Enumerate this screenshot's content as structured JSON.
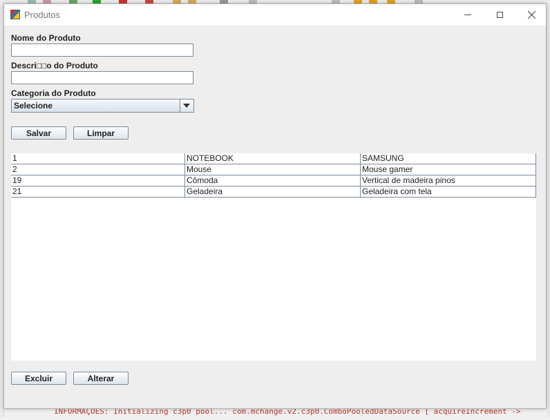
{
  "window": {
    "title": "Produtos",
    "icon": "java-app-icon"
  },
  "form": {
    "nome_label": "Nome do Produto",
    "nome_value": "",
    "descricao_label": "Descri□□o do Produto",
    "descricao_value": "",
    "categoria_label": "Categoria do Produto",
    "categoria_selected": "Selecione"
  },
  "buttons": {
    "salvar": "Salvar",
    "limpar": "Limpar",
    "excluir": "Excluir",
    "alterar": "Alterar"
  },
  "table": {
    "rows": [
      [
        "1",
        "NOTEBOOK",
        "SAMSUNG"
      ],
      [
        "2",
        "Mouse",
        "Mouse gamer"
      ],
      [
        "19",
        "Cômoda",
        "Vertical de madeira pinos"
      ],
      [
        "21",
        "Geladeira",
        "Geladeira com tela"
      ]
    ]
  },
  "background": {
    "log_text": "INFORMAÇÕES: Initializing c3p0 pool... com.mchange.v2.c3p0.ComboPooledDataSource [ acquireIncrement ->"
  },
  "colors": {
    "log": "#c0392b",
    "border": "#7a8a99"
  }
}
